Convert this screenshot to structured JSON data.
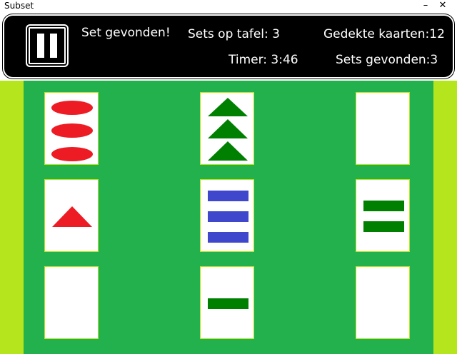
{
  "window": {
    "title": "Subset",
    "minimize_glyph": "–",
    "close_glyph": "✕"
  },
  "hud": {
    "status": "Set gevonden!",
    "sets_on_table_label": "Sets op tafel: 3",
    "covered_cards_label": "Gedekte kaarten:12",
    "timer_label": "Timer: 3:46",
    "sets_found_label": "Sets gevonden:3"
  },
  "colors": {
    "red": "#ed1c24",
    "green": "#008000",
    "blue": "#3f48cc",
    "table": "#22b14c",
    "side": "#b5e61d"
  },
  "cards": [
    {
      "shape": "oval",
      "color": "red",
      "count": 3
    },
    {
      "shape": "triangle",
      "color": "green",
      "count": 3
    },
    {
      "shape": "none",
      "color": "none",
      "count": 0
    },
    {
      "shape": "triangle",
      "color": "red",
      "count": 1
    },
    {
      "shape": "rectangle",
      "color": "blue",
      "count": 3
    },
    {
      "shape": "rectangle",
      "color": "green",
      "count": 2
    },
    {
      "shape": "none",
      "color": "none",
      "count": 0
    },
    {
      "shape": "rectangle",
      "color": "green",
      "count": 1
    },
    {
      "shape": "none",
      "color": "none",
      "count": 0
    }
  ]
}
